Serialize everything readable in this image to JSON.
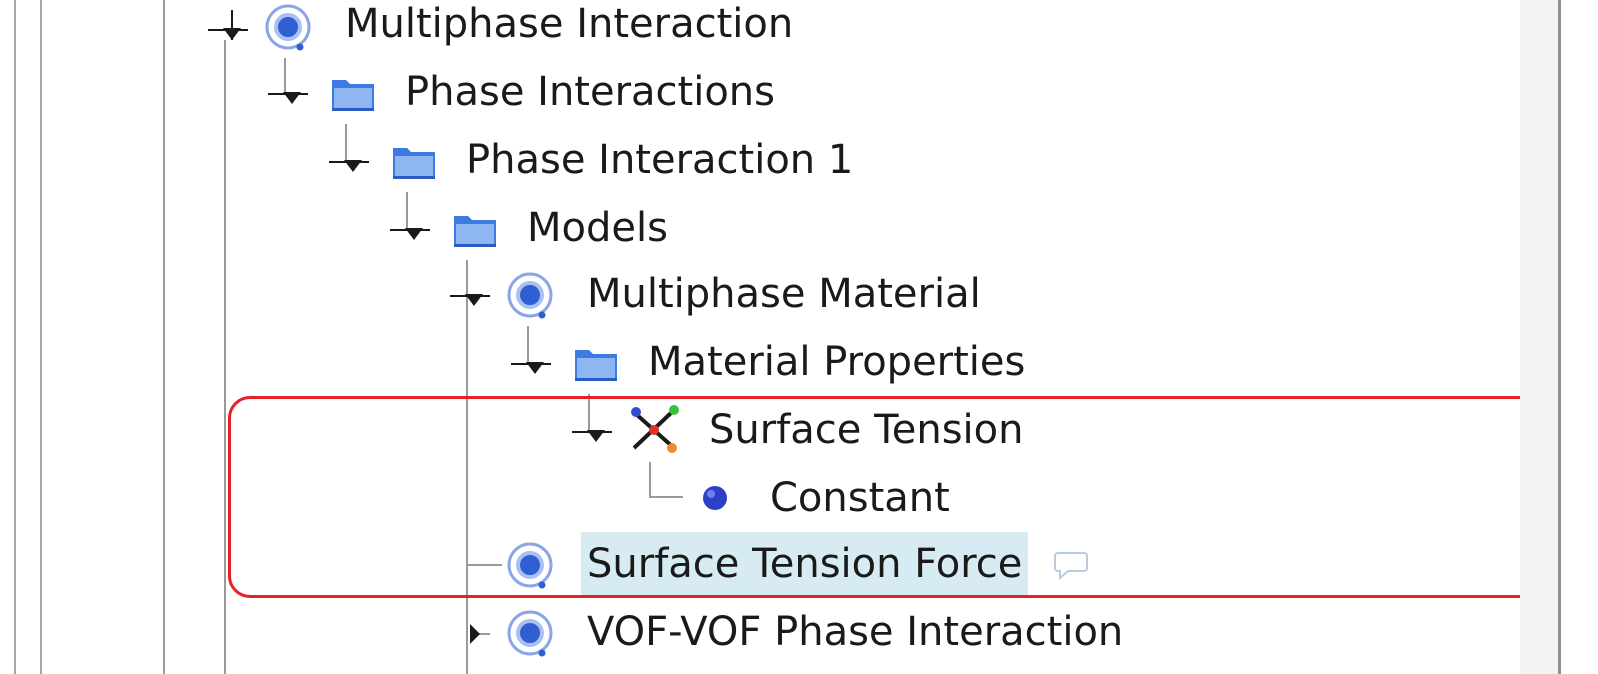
{
  "tree": {
    "items": [
      {
        "label": "Multiphase Interaction",
        "icon": "model-node-icon",
        "expanded": true
      },
      {
        "label": "Phase Interactions",
        "icon": "folder-icon",
        "expanded": true
      },
      {
        "label": "Phase Interaction 1",
        "icon": "folder-icon",
        "expanded": true
      },
      {
        "label": "Models",
        "icon": "folder-icon",
        "expanded": true
      },
      {
        "label": "Multiphase Material",
        "icon": "model-node-icon",
        "expanded": true
      },
      {
        "label": "Material Properties",
        "icon": "folder-icon",
        "expanded": true
      },
      {
        "label": "Surface Tension",
        "icon": "property-icon",
        "expanded": true
      },
      {
        "label": "Constant",
        "icon": "method-dot-icon",
        "expanded": false
      },
      {
        "label": "Surface Tension Force",
        "icon": "model-node-icon",
        "selected": true
      },
      {
        "label": "VOF-VOF Phase Interaction",
        "icon": "model-node-icon",
        "expanded": false
      }
    ]
  },
  "colors": {
    "highlight": "#e8202a",
    "selection": "#d6ecf2",
    "node_blue": "#2f5fd0",
    "folder_blue": "#3d7be0"
  }
}
